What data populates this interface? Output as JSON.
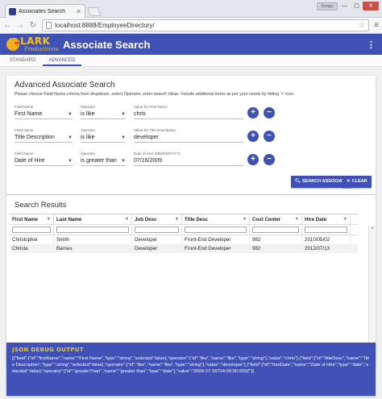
{
  "browser": {
    "tab_title": "Associates Search",
    "url": "localhost:8888/EmployeeDirectory/",
    "profile": "Scrapy"
  },
  "app": {
    "logo_text": "LARK",
    "logo_sub": "Productions",
    "title": "Associate Search",
    "tabs": [
      "STANDARD",
      "ADVANCED"
    ],
    "active_tab": "ADVANCED"
  },
  "advanced": {
    "title": "Advanced Associate Search",
    "hint": "Please choose Field Name criteria from dropdown, select Operator, enter search Value. Include additional items as per your needs by hitting '+' icon.",
    "field_label": "Field Name",
    "operator_label": "Operator",
    "rows": [
      {
        "field": "First Name",
        "operator": "is like",
        "value_label": "Value for First Name",
        "value": "chris"
      },
      {
        "field": "Title Description",
        "operator": "is like",
        "value_label": "Value for Title Description",
        "value": "developer"
      },
      {
        "field": "Date of Hire",
        "operator": "is greater than",
        "value_label": "Date of Hire (MM/DD/YYYY)",
        "value": "07/16/2009"
      }
    ],
    "search_button": "SEARCH ASSOCIATE",
    "clear_button": "CLEAR"
  },
  "results": {
    "title": "Search Results",
    "columns": [
      "First Name",
      "Last Name",
      "Job Desc",
      "Title Desc",
      "Cost Center",
      "Hire Date"
    ],
    "rows": [
      [
        "Christopher",
        "Smith",
        "Developer",
        "Front-End Developer",
        "982",
        "2010/05/02"
      ],
      [
        "Christa",
        "Barnes",
        "Developer",
        "Front-End Developer",
        "982",
        "2012/07/13"
      ]
    ]
  },
  "debug": {
    "title": "JSON DEBUG OUTPUT",
    "body": "[{\"field\":{\"id\":\"firstName\",\"name\":\"First Name\",\"type\":\"string\",\"selected\":false},\"operator\":{\"id\":\"like\",\"name\":\"like\",\"type\":\"string\"},\"value\":\"chris\"},{\"field\":{\"id\":\"titleDesc\",\"name\":\"Title Description\",\"type\":\"string\",\"selected\":false},\"operator\":{\"id\":\"like\",\"name\":\"like\",\"type\":\"string\"},\"value\":\"developer\"},{\"field\":{\"id\":\"hireDate\",\"name\":\"Date of Hire\",\"type\":\"date\",\"selected\":false},\"operator\":{\"id\":\"greaterThan\",\"name\":\"greater than\",\"type\":\"date\"},\"value\":\"2009-07-16T04:00:00.000Z\"}]"
  },
  "colors": {
    "primary": "#3f51b5",
    "accent": "#f4c21a"
  }
}
